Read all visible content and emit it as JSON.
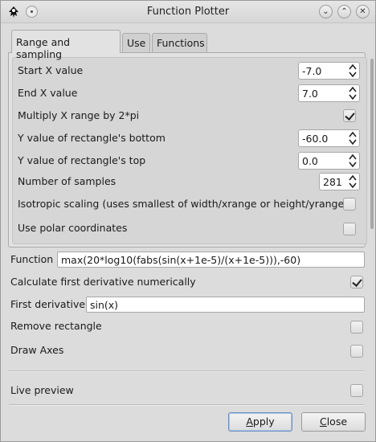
{
  "window": {
    "title": "Function Plotter"
  },
  "tabs": [
    {
      "label": "Range and sampling",
      "active": true
    },
    {
      "label": "Use",
      "active": false
    },
    {
      "label": "Functions",
      "active": false
    }
  ],
  "range": {
    "start_x": {
      "label": "Start X value",
      "value": "-7.0"
    },
    "end_x": {
      "label": "End X value",
      "value": "7.0"
    },
    "multiply_2pi": {
      "label": "Multiply X range by 2*pi",
      "checked": true
    },
    "y_bottom": {
      "label": "Y value of rectangle's bottom",
      "value": "-60.0"
    },
    "y_top": {
      "label": "Y value of rectangle's top",
      "value": "0.0"
    },
    "samples": {
      "label": "Number of samples",
      "value": "281"
    },
    "isotropic": {
      "label": "Isotropic scaling (uses smallest of width/xrange or height/yrange)",
      "checked": false
    },
    "polar": {
      "label": "Use polar coordinates",
      "checked": false
    }
  },
  "function": {
    "label": "Function",
    "value": "max(20*log10(fabs(sin(x+1e-5)/(x+1e-5))),-60)"
  },
  "derivative_numeric": {
    "label": "Calculate first derivative numerically",
    "checked": true
  },
  "first_derivative": {
    "label": "First derivative",
    "value": "sin(x)"
  },
  "remove_rectangle": {
    "label": "Remove rectangle",
    "checked": false
  },
  "draw_axes": {
    "label": "Draw Axes",
    "checked": false
  },
  "live_preview": {
    "label": "Live preview",
    "checked": false
  },
  "buttons": {
    "apply": "Apply",
    "close": "Close"
  },
  "icons": {
    "app": "inkscape-icon",
    "pin": "pin-icon",
    "minimize": "chevron-down-icon",
    "maximize": "chevron-up-icon",
    "close": "close-icon"
  }
}
